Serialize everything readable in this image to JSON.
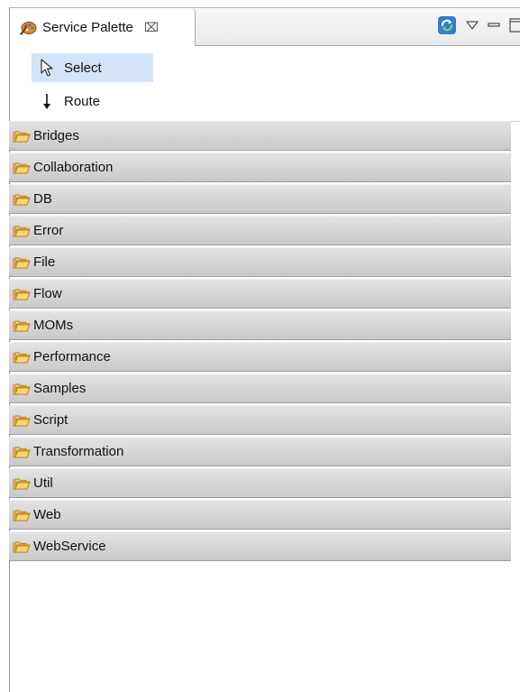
{
  "view": {
    "title": "Service Palette",
    "close_symbol": "⌧",
    "tool_icons": [
      "refresh-icon",
      "view-menu-icon",
      "minimize-icon",
      "maximize-icon"
    ]
  },
  "tools": [
    {
      "label": "Select",
      "icon": "arrow-cursor-icon",
      "selected": true
    },
    {
      "label": "Route",
      "icon": "down-arrow-icon",
      "selected": false
    }
  ],
  "drawers": [
    {
      "label": "Bridges"
    },
    {
      "label": "Collaboration"
    },
    {
      "label": "DB"
    },
    {
      "label": "Error"
    },
    {
      "label": "File"
    },
    {
      "label": "Flow"
    },
    {
      "label": "MOMs"
    },
    {
      "label": "Performance"
    },
    {
      "label": "Samples"
    },
    {
      "label": "Script"
    },
    {
      "label": "Transformation"
    },
    {
      "label": "Util"
    },
    {
      "label": "Web"
    },
    {
      "label": "WebService"
    }
  ],
  "colors": {
    "selection": "#d4e3f7",
    "drawer_top": "#e3e3e3",
    "drawer_bottom": "#c9c9c9",
    "folder": "#e8b64a"
  }
}
